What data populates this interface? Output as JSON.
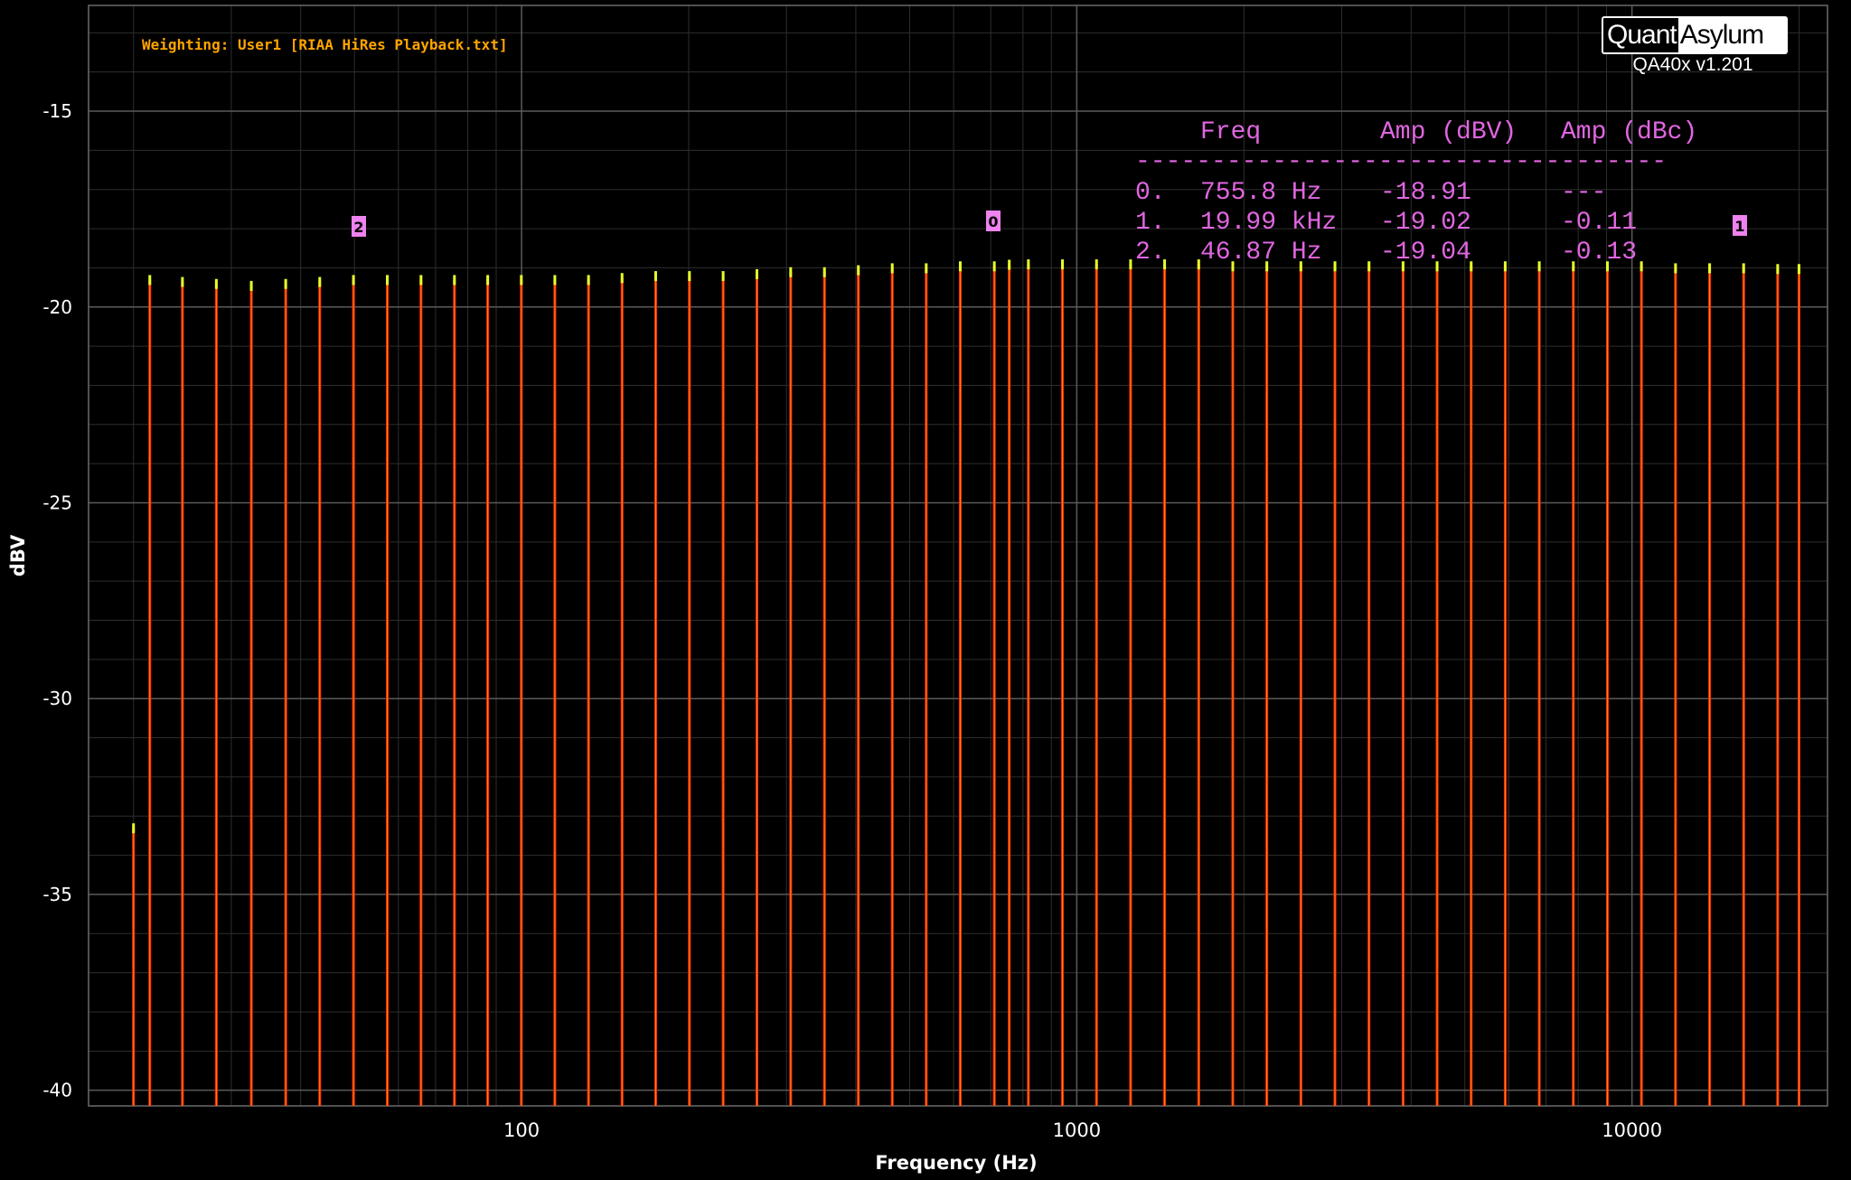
{
  "brand": {
    "left": "Quant",
    "right": "Asylum",
    "version": "QA40x v1.201"
  },
  "weighting_text": "Weighting: User1 [RIAA HiRes Playback.txt]",
  "marker_table": {
    "headers": [
      "Freq",
      "Amp (dBV)",
      "Amp (dBc)"
    ],
    "separator": "-----------------------------------",
    "rows": [
      {
        "idx": "0.",
        "freq": "755.8 Hz",
        "amp_dbv": "-18.91",
        "amp_dbc": "---"
      },
      {
        "idx": "1.",
        "freq": "19.99 kHz",
        "amp_dbv": "-19.02",
        "amp_dbc": "-0.11"
      },
      {
        "idx": "2.",
        "freq": "46.87 Hz",
        "amp_dbv": "-19.04",
        "amp_dbc": "-0.13"
      }
    ]
  },
  "colors": {
    "background": "#000000",
    "grid": "#5a5a5a",
    "grid_minor": "#2e2e2e",
    "trace": "#ff2a00",
    "trace_inner": "#ff8c1a",
    "peak_cap": "#e6ff2a",
    "marker_box": "#ee82ee",
    "marker_text": "#e066e0"
  },
  "chart_data": {
    "type": "line",
    "title": "",
    "xlabel": "Frequency (Hz)",
    "ylabel": "dBV",
    "xscale": "log",
    "xlim": [
      16.6,
      22500
    ],
    "ylim": [
      -40.4,
      -12.3
    ],
    "x_ticks": [
      100,
      1000,
      10000
    ],
    "x_tick_labels": [
      "100",
      "1000",
      "10000"
    ],
    "y_ticks": [
      -15,
      -20,
      -25,
      -30,
      -35,
      -40
    ],
    "y_tick_labels": [
      "-15",
      "-20",
      "-25",
      "-30",
      "-35",
      "-40"
    ],
    "grid": true,
    "series": [
      {
        "tones_hz": [
          20.0,
          21.4,
          24.5,
          28.2,
          32.6,
          37.6,
          43.3,
          49.8,
          57.3,
          65.9,
          75.7,
          86.9,
          99.9,
          114.8,
          132.0,
          151.7,
          174.4,
          200.6,
          230.7,
          265.4,
          305.3,
          351.2,
          404.2,
          465.2,
          535.6,
          616.8,
          710.4,
          755.8,
          818.2,
          942.4,
          1085.4,
          1250.1,
          1439.6,
          1658.2,
          1909.9,
          2199.5,
          2533.1,
          2917.6,
          3360.3,
          3869.8,
          4456.7,
          5133.0,
          5911.5,
          6808.4,
          7841.2,
          9031.2,
          10400,
          11980,
          13800,
          15890,
          18300,
          19990
        ],
        "peak_dbv": [
          -33.3,
          -19.3,
          -19.35,
          -19.4,
          -19.45,
          -19.4,
          -19.35,
          -19.3,
          -19.3,
          -19.3,
          -19.3,
          -19.3,
          -19.3,
          -19.3,
          -19.3,
          -19.25,
          -19.2,
          -19.2,
          -19.2,
          -19.15,
          -19.1,
          -19.1,
          -19.05,
          -19.0,
          -19.0,
          -18.95,
          -18.95,
          -18.91,
          -18.9,
          -18.9,
          -18.9,
          -18.9,
          -18.9,
          -18.9,
          -18.95,
          -18.95,
          -18.95,
          -18.95,
          -18.95,
          -18.95,
          -18.95,
          -18.95,
          -18.95,
          -18.95,
          -18.95,
          -18.95,
          -18.95,
          -19.0,
          -19.0,
          -19.0,
          -19.02,
          -19.02
        ]
      }
    ],
    "markers": [
      {
        "label": "0",
        "freq_hz": 755.8,
        "amp_dbv": -18.91
      },
      {
        "label": "1",
        "freq_hz": 19990,
        "amp_dbv": -19.02
      },
      {
        "label": "2",
        "freq_hz": 46.87,
        "amp_dbv": -19.04
      }
    ]
  }
}
